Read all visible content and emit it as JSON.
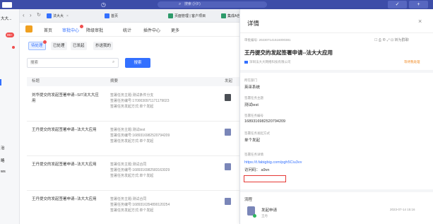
{
  "titlebar": {
    "search_placeholder": "搜索 (⌘F)",
    "minimize_label": "✓",
    "add_label": "+"
  },
  "sidebar": {
    "items": [
      "大大...",
      "",
      "",
      "",
      "",
      "",
      "治",
      "略",
      "ws"
    ],
    "badge": "99+"
  },
  "browser_tabs": [
    {
      "label": "法大大"
    },
    {
      "label": "首页"
    },
    {
      "label": "页面管理 | 客户项目"
    },
    {
      "label": "集成A自动化 | 客户..."
    }
  ],
  "topnav": {
    "items": [
      "首页",
      "审批中心",
      "降级审批",
      "统计",
      "插件中心",
      "更多"
    ],
    "active_index": 1
  },
  "filter_tabs": {
    "items": [
      "待处理",
      "已处理",
      "已发起",
      "抄送我的"
    ],
    "active_index": 0
  },
  "search": {
    "placeholder": "搜索",
    "button_label": "搜索"
  },
  "table": {
    "columns": [
      "标题",
      "摘要",
      "发起"
    ],
    "rows": [
      {
        "title": "刘华提交的发起签署申请--SIT法大大应用",
        "summary": [
          "签署任务主题:测试条件分支",
          "签署任务编号:1700030971171179023",
          "签署任务发起方式:单个发起"
        ],
        "avatar": "dark"
      },
      {
        "title": "王丹提交的发起签署申请--法大大应用",
        "summary": [
          "签署任务主题:测试test",
          "签署任务编号:1689316982520794209",
          "签署任务发起方式:单个发起"
        ],
        "avatar": "light"
      },
      {
        "title": "王丹提交的发起签署申请--法大大应用",
        "summary": [
          "签署任务主题:测试合同",
          "签署任务编号:1689316982583163029",
          "签署任务发起方式:单个发起"
        ],
        "avatar": "light"
      },
      {
        "title": "王丹提交的发起签署申请--法大大应用",
        "summary": [
          "签署任务主题:测试合同",
          "签署任务编号:1689316354890120254",
          "签署任务发起方式:单个发起"
        ],
        "avatar": "light"
      }
    ]
  },
  "detail": {
    "title": "详情",
    "approval_no": "审批编号: 202307141516000381",
    "tools": "☐ ⎙ ⊕ ⤢  ⊡ 转为群聊",
    "heading": "王丹提交的发起签署申请--法大大应用",
    "org": "深圳法大大网络科技有限公司",
    "status": "等待我处理",
    "fields": [
      {
        "label": "所在部门",
        "value": "英巫系统"
      },
      {
        "label": "签署任务主题",
        "value": "测试test"
      },
      {
        "label": "签署任务编号",
        "value": "1689316982520794209"
      },
      {
        "label": "签署任务发起方式",
        "value": "单个发起"
      }
    ],
    "detail_label": "签署任务详情",
    "detail_link": "https://t.fabigbig.com/pgh5Ciu3vv",
    "access_code": "访问码： a9vn",
    "flow_title": "流程",
    "flow_node": "发起申请",
    "flow_user": "王丹",
    "flow_time": "2023-07-14 15:16"
  }
}
